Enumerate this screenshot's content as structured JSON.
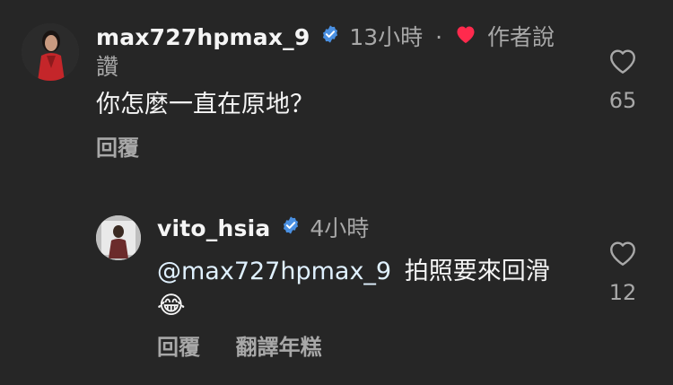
{
  "comments": [
    {
      "username": "max727hpmax_9",
      "verified": true,
      "time": "13小時",
      "separator": "·",
      "author_liked": "作者說讚",
      "text": "你怎麼一直在原地？",
      "likes": "65",
      "actions": {
        "reply": "回覆"
      }
    },
    {
      "username": "vito_hsia",
      "verified": true,
      "time": "4小時",
      "mention": "@max727hpmax_9",
      "text": "拍照要來回滑",
      "emoji": "😂",
      "likes": "12",
      "actions": {
        "reply": "回覆",
        "translate": "翻譯年糕"
      }
    }
  ],
  "colors": {
    "background": "#262626",
    "primary_text": "#f5f5f5",
    "secondary_text": "#a8a8a8",
    "verified_blue": "#4a90e2",
    "heart_red": "#ff2a4d"
  },
  "icons": {
    "verified": "verified-badge-icon",
    "author_heart": "heart-filled-icon",
    "like": "heart-outline-icon"
  }
}
